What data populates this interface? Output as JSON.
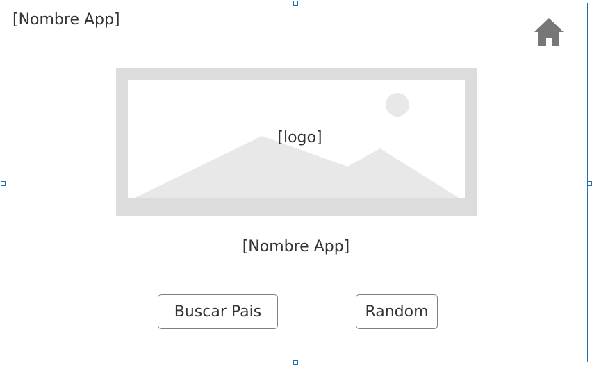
{
  "header": {
    "app_name": "[Nombre App]",
    "home_icon": "home-icon"
  },
  "logo": {
    "label": "[logo]",
    "icon": "image-placeholder-icon"
  },
  "main": {
    "app_name": "[Nombre App]"
  },
  "actions": {
    "search_country_label": "Buscar Pais",
    "random_label": "Random"
  },
  "colors": {
    "frame_border": "#1f6fb2",
    "placeholder_gray": "#dcdcdc",
    "placeholder_light": "#e8e8e8",
    "icon_gray": "#777777",
    "text": "#333333"
  }
}
